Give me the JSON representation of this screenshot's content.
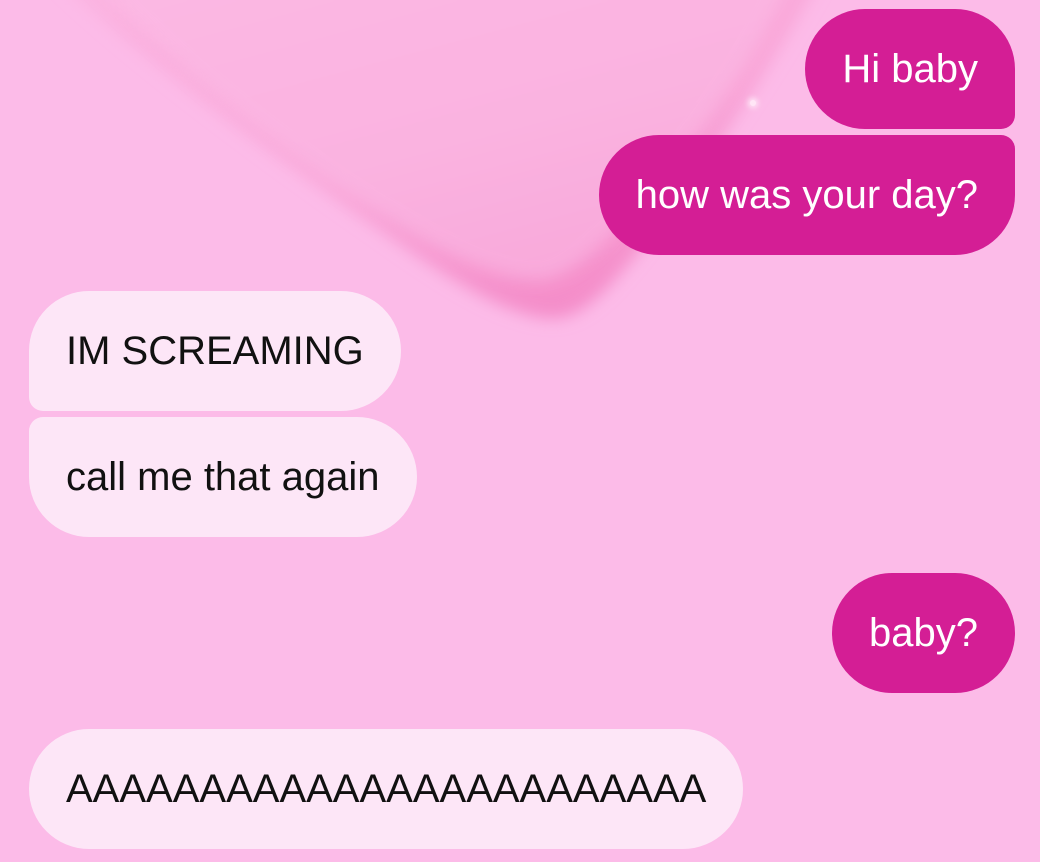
{
  "conversation": {
    "messages": [
      {
        "text": "Hi baby",
        "direction": "sent"
      },
      {
        "text": "how was your day?",
        "direction": "sent"
      },
      {
        "text": "IM SCREAMING",
        "direction": "received"
      },
      {
        "text": "call me that again",
        "direction": "received"
      },
      {
        "text": "baby?",
        "direction": "sent"
      },
      {
        "text": "AAAAAAAAAAAAAAAAAAAAAAAA",
        "direction": "received"
      }
    ]
  },
  "theme": {
    "background": "#fcbbe8",
    "sent_bubble": "#d41e95",
    "received_bubble": "#fde6f7",
    "heart_decoration": "#f7a0d4"
  }
}
